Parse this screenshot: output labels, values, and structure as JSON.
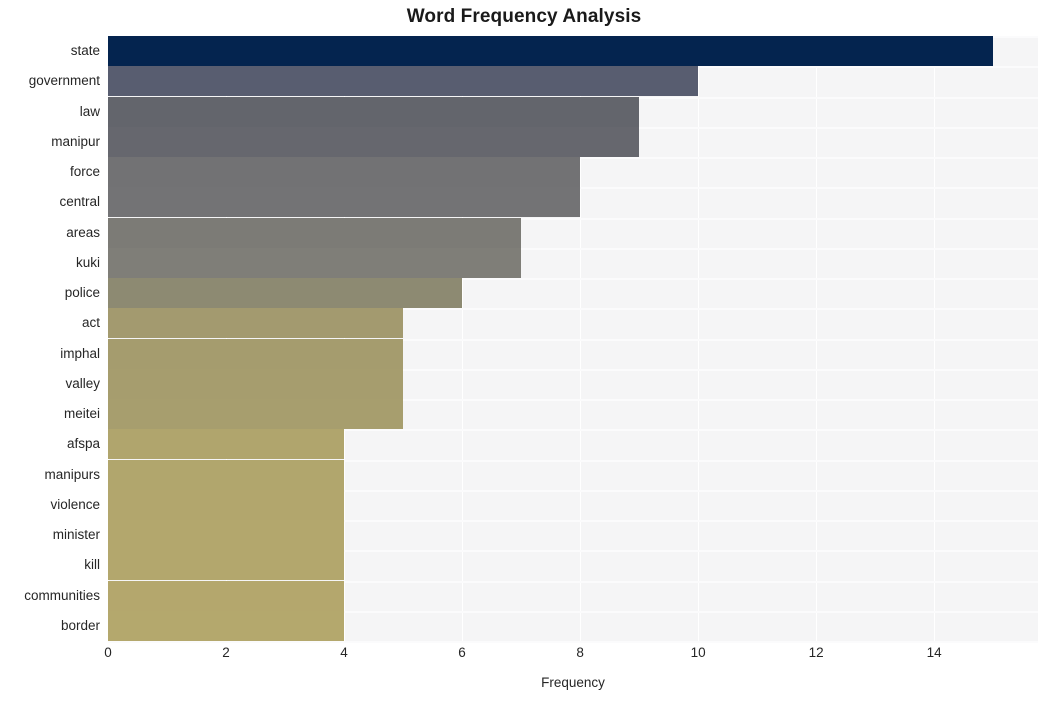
{
  "chart_data": {
    "type": "bar",
    "orientation": "horizontal",
    "title": "Word Frequency Analysis",
    "xlabel": "Frequency",
    "ylabel": "",
    "xlim": [
      0,
      15.76
    ],
    "ylim": [
      0,
      20
    ],
    "grid": true,
    "legend": null,
    "xticks": [
      "0",
      "2",
      "4",
      "6",
      "8",
      "10",
      "12",
      "14"
    ],
    "xtick_values": [
      0,
      2,
      4,
      6,
      8,
      10,
      12,
      14
    ],
    "categories": [
      "state",
      "government",
      "law",
      "manipur",
      "force",
      "central",
      "areas",
      "kuki",
      "police",
      "act",
      "imphal",
      "valley",
      "meitei",
      "afspa",
      "manipurs",
      "violence",
      "minister",
      "kill",
      "communities",
      "border"
    ],
    "values": [
      15,
      10,
      9,
      9,
      8,
      8,
      7,
      7,
      6,
      5,
      5,
      5,
      5,
      4,
      4,
      4,
      4,
      4,
      4,
      4
    ],
    "bar_colors": [
      "#04244f",
      "#585d70",
      "#63656c",
      "#66676e",
      "#727274",
      "#737375",
      "#7c7b76",
      "#7f7e78",
      "#8d8a72",
      "#a39a6f",
      "#a59c6e",
      "#a69d6e",
      "#a79e6e",
      "#b0a56d",
      "#b1a66d",
      "#b2a66d",
      "#b3a76d",
      "#b3a76d",
      "#b4a76d",
      "#b4a86d"
    ],
    "plot_background": "#f5f5f6",
    "gridline_color": "#ffffff",
    "page_background": "#ffffff",
    "text_color": "#262626"
  }
}
